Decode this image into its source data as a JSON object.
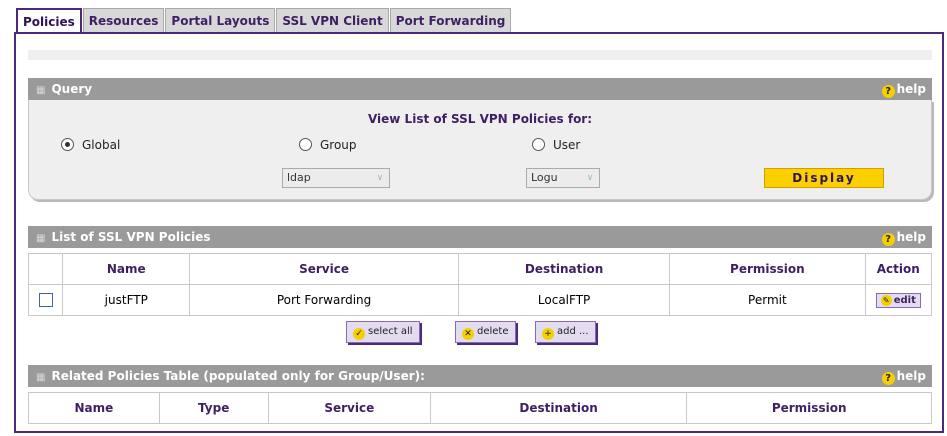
{
  "tabs": [
    "Policies",
    "Resources",
    "Portal Layouts",
    "SSL VPN Client",
    "Port Forwarding"
  ],
  "query": {
    "header": "Query",
    "help": "help",
    "title": "View List of SSL VPN Policies for:",
    "radio_global": "Global",
    "radio_group": "Group",
    "radio_user": "User",
    "group_select": "ldap",
    "user_select": "Logu",
    "display_button": "Display"
  },
  "policies": {
    "header": "List of SSL VPN Policies",
    "help": "help",
    "columns": [
      "Name",
      "Service",
      "Destination",
      "Permission",
      "Action"
    ],
    "rows": [
      {
        "name": "justFTP",
        "service": "Port Forwarding",
        "destination": "LocalFTP",
        "permission": "Permit",
        "action": "edit"
      }
    ],
    "select_all": "select all",
    "delete": "delete",
    "add": "add ..."
  },
  "related": {
    "header": "Related Policies Table (populated only for Group/User):",
    "help": "help",
    "columns": [
      "Name",
      "Type",
      "Service",
      "Destination",
      "Permission"
    ]
  },
  "colors": {
    "accent": "#4b2a7b",
    "header_gray": "#9a9a9a",
    "display_button": "#fccf00"
  }
}
